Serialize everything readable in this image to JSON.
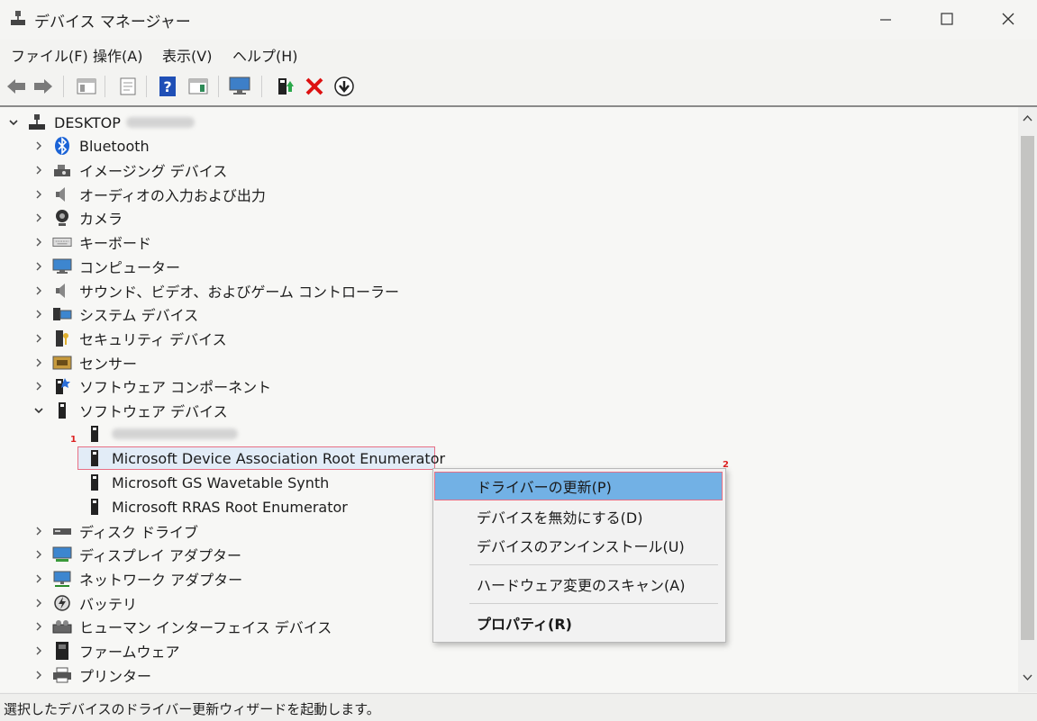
{
  "window": {
    "title": "デバイス マネージャー"
  },
  "menu": [
    "ファイル(F)",
    "操作(A)",
    "表示(V)",
    "ヘルプ(H)"
  ],
  "toolbar": [
    "back-icon",
    "forward-icon",
    "properties-window-icon",
    "print-icon",
    "help-icon",
    "view-icon",
    "monitor-icon",
    "update-driver-icon",
    "uninstall-icon",
    "download-icon"
  ],
  "tree": {
    "root": "DESKTOP",
    "categories": [
      "Bluetooth",
      "イメージング デバイス",
      "オーディオの入力および出力",
      "カメラ",
      "キーボード",
      "コンピューター",
      "サウンド、ビデオ、およびゲーム コントローラー",
      "システム デバイス",
      "セキュリティ デバイス",
      "センサー",
      "ソフトウェア コンポーネント",
      "ソフトウェア デバイス"
    ],
    "software_devices": [
      "Microsoft Device Association Root Enumerator",
      "Microsoft GS Wavetable Synth",
      "Microsoft RRAS Root Enumerator"
    ],
    "categories_after": [
      "ディスク ドライブ",
      "ディスプレイ アダプター",
      "ネットワーク アダプター",
      "バッテリ",
      "ヒューマン インターフェイス デバイス",
      "ファームウェア",
      "プリンター"
    ]
  },
  "markers": [
    "1",
    "2"
  ],
  "context_menu": [
    "ドライバーの更新(P)",
    "デバイスを無効にする(D)",
    "デバイスのアンインストール(U)",
    "ハードウェア変更のスキャン(A)",
    "プロパティ(R)"
  ],
  "status": "選択したデバイスのドライバー更新ウィザードを起動します。",
  "colors": {
    "highlight": "#72b1e5",
    "annotation": "#e86f84"
  }
}
